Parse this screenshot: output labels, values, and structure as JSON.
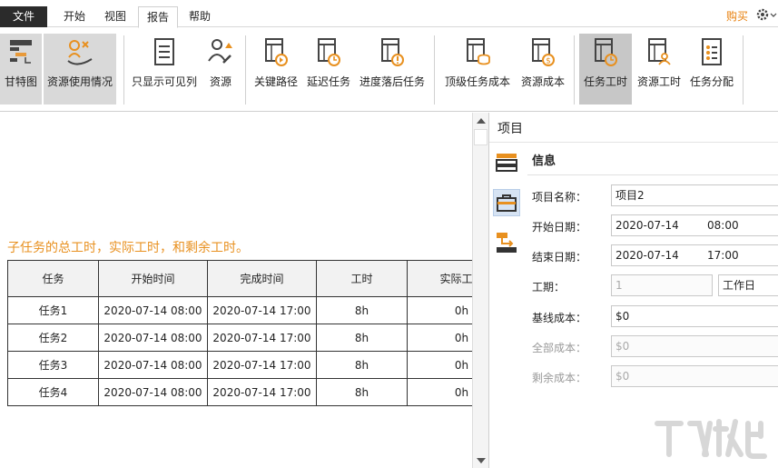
{
  "menu": {
    "file": "文件",
    "tabs": [
      "开始",
      "视图",
      "报告",
      "帮助"
    ],
    "active_tab": "报告",
    "buy": "购买"
  },
  "ribbon": {
    "buttons": [
      {
        "label": "甘特图",
        "icon": "gantt-icon"
      },
      {
        "label": "资源使用情况",
        "icon": "resource-usage-icon"
      },
      {
        "label": "只显示可见列",
        "icon": "visible-columns-icon"
      },
      {
        "label": "资源",
        "icon": "resource-icon"
      },
      {
        "label": "关键路径",
        "icon": "critical-path-icon"
      },
      {
        "label": "延迟任务",
        "icon": "delayed-tasks-icon"
      },
      {
        "label": "进度落后任务",
        "icon": "behind-schedule-icon"
      },
      {
        "label": "顶级任务成本",
        "icon": "top-task-cost-icon"
      },
      {
        "label": "资源成本",
        "icon": "resource-cost-icon"
      },
      {
        "label": "任务工时",
        "icon": "task-work-icon"
      },
      {
        "label": "资源工时",
        "icon": "resource-work-icon"
      },
      {
        "label": "任务分配",
        "icon": "task-assignment-icon"
      }
    ]
  },
  "report": {
    "description": "子任务的总工时，实际工时，和剩余工时。",
    "columns": [
      "任务",
      "开始时间",
      "完成时间",
      "工时",
      "实际工时"
    ],
    "rows": [
      [
        "任务1",
        "2020-07-14 08:00",
        "2020-07-14 17:00",
        "8h",
        "0h"
      ],
      [
        "任务2",
        "2020-07-14 08:00",
        "2020-07-14 17:00",
        "8h",
        "0h"
      ],
      [
        "任务3",
        "2020-07-14 08:00",
        "2020-07-14 17:00",
        "8h",
        "0h"
      ],
      [
        "任务4",
        "2020-07-14 08:00",
        "2020-07-14 17:00",
        "8h",
        "0h"
      ]
    ]
  },
  "panel": {
    "title": "项目",
    "section": "信息",
    "fields": {
      "name_label": "项目名称：",
      "name_value": "项目2",
      "start_label": "开始日期：",
      "start_date": "2020-07-14",
      "start_time": "08:00",
      "end_label": "结束日期：",
      "end_date": "2020-07-14",
      "end_time": "17:00",
      "duration_label": "工期：",
      "duration_value": "1",
      "duration_unit": "工作日",
      "baseline_label": "基线成本：",
      "baseline_value": "$0",
      "total_label": "全部成本：",
      "total_value": "$0",
      "remaining_label": "剩余成本：",
      "remaining_value": "$0"
    }
  },
  "colors": {
    "accent_orange": "#e8901f",
    "ribbon_selected": "#c7c7c7",
    "file_menu_bg": "#2b2b2b"
  }
}
